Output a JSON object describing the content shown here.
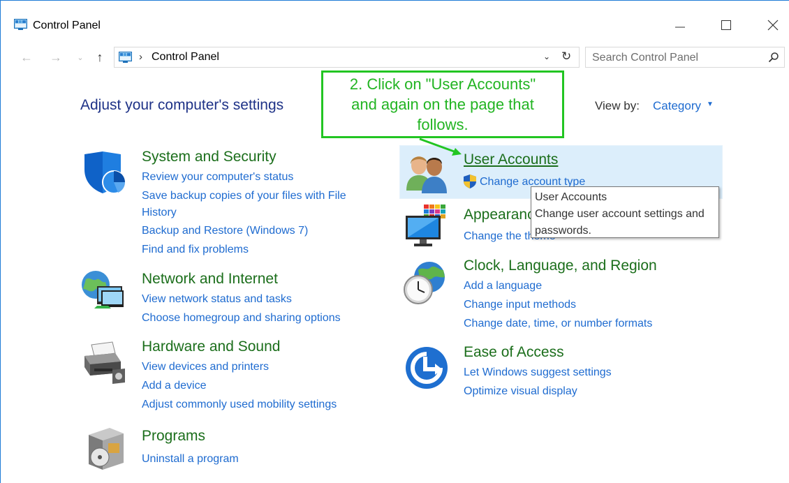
{
  "window": {
    "title": "Control Panel"
  },
  "address_bar": {
    "path": "Control Panel",
    "search_placeholder": "Search Control Panel"
  },
  "main": {
    "heading": "Adjust your computer's settings",
    "view_by_label": "View by:",
    "view_by_value": "Category"
  },
  "categories": {
    "system_security": {
      "title": "System and Security",
      "links": [
        "Review your computer's status",
        "Save backup copies of your files with File",
        "History",
        "Backup and Restore (Windows 7)",
        "Find and fix problems"
      ]
    },
    "network": {
      "title": "Network and Internet",
      "links": [
        "View network status and tasks",
        "Choose homegroup and sharing options"
      ]
    },
    "hardware": {
      "title": "Hardware and Sound",
      "links": [
        "View devices and printers",
        "Add a device",
        "Adjust commonly used mobility settings"
      ]
    },
    "programs": {
      "title": "Programs",
      "links": [
        "Uninstall a program"
      ]
    },
    "user_accounts": {
      "title": "User Accounts",
      "links": [
        "Change account type"
      ]
    },
    "appearance": {
      "title": "Appearance and Personalization",
      "links": [
        "Change the theme"
      ]
    },
    "clock": {
      "title": "Clock, Language, and Region",
      "links": [
        "Add a language",
        "Change input methods",
        "Change date, time, or number formats"
      ]
    },
    "ease": {
      "title": "Ease of Access",
      "links": [
        "Let Windows suggest settings",
        "Optimize visual display"
      ]
    }
  },
  "tooltip": {
    "line1": "User Accounts",
    "line2": "Change user account settings and",
    "line3": "passwords."
  },
  "callout": {
    "line1": "2. Click on \"User Accounts\"",
    "line2": "and again on the page that",
    "line3": "follows."
  },
  "colors": {
    "link": "#1e6bd0",
    "category_title": "#1b6e1b",
    "heading": "#1e3287",
    "callout": "#22c522"
  }
}
